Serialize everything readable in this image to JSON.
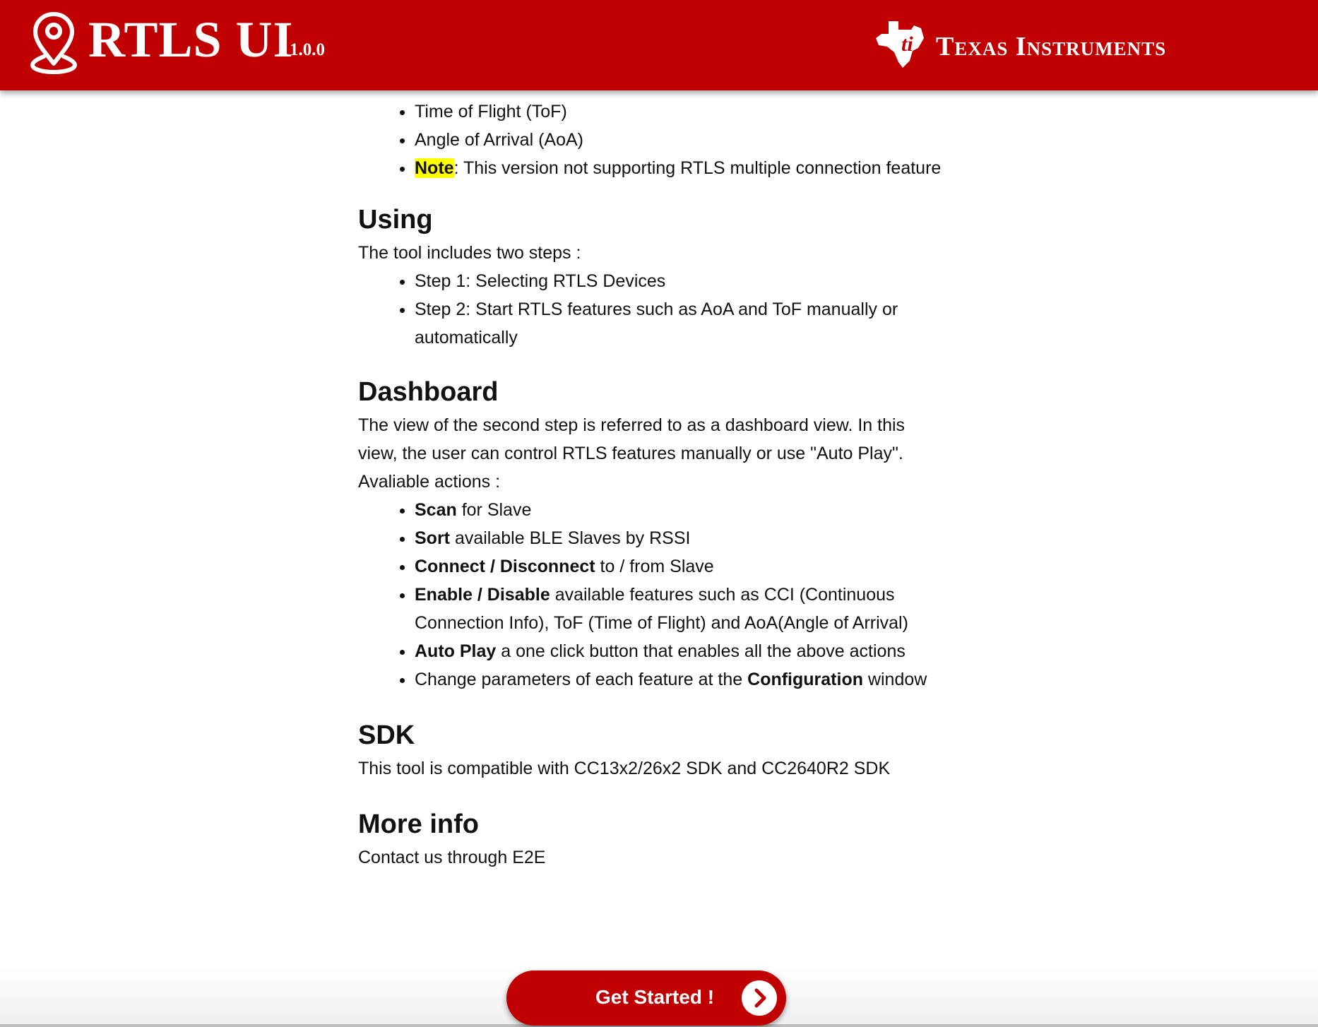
{
  "header": {
    "app_title": "RTLS UI",
    "version": "1.0.0",
    "brand": "Texas Instruments",
    "bg_color": "#c00000"
  },
  "intro_list": {
    "items": [
      {
        "text": "Time of Flight (ToF)"
      },
      {
        "text": "Angle of Arrival (AoA)"
      },
      {
        "highlight": "Note",
        "text": ": This version not supporting RTLS multiple connection feature"
      }
    ]
  },
  "using": {
    "heading": "Using",
    "text": "The tool includes two steps :",
    "items": [
      "Step 1: Selecting RTLS Devices",
      "Step 2: Start RTLS features such as AoA and ToF manually or automatically"
    ]
  },
  "dashboard": {
    "heading": "Dashboard",
    "text": "The view of the second step is referred to as a dashboard view. In this view, the user can control RTLS features manually or use \"Auto Play\". Avaliable actions :",
    "items": [
      {
        "bold": "Scan",
        "text": " for Slave"
      },
      {
        "bold": "Sort",
        "text": " available BLE Slaves by RSSI"
      },
      {
        "bold": "Connect / Disconnect",
        "text": " to / from Slave"
      },
      {
        "bold": "Enable / Disable",
        "text": " available features such as CCI (Continuous Connection Info), ToF (Time of Flight) and AoA(Angle of Arrival)"
      },
      {
        "bold": "Auto Play",
        "text": " a one click button that enables all the above actions"
      },
      {
        "pre": "Change parameters of each feature at the ",
        "bold": "Configuration",
        "post": " window"
      }
    ]
  },
  "sdk": {
    "heading": "SDK",
    "text": "This tool is compatible with CC13x2/26x2 SDK and CC2640R2 SDK"
  },
  "more_info": {
    "heading": "More info",
    "text": "Contact us through E2E"
  },
  "cta": {
    "label": "Get Started !"
  },
  "icons": {
    "header_left": "map-pin-icon",
    "header_right": "ti-logo-icon",
    "cta": "chevron-right-icon"
  },
  "colors": {
    "accent": "#c00000",
    "highlight": "#ffff00"
  }
}
